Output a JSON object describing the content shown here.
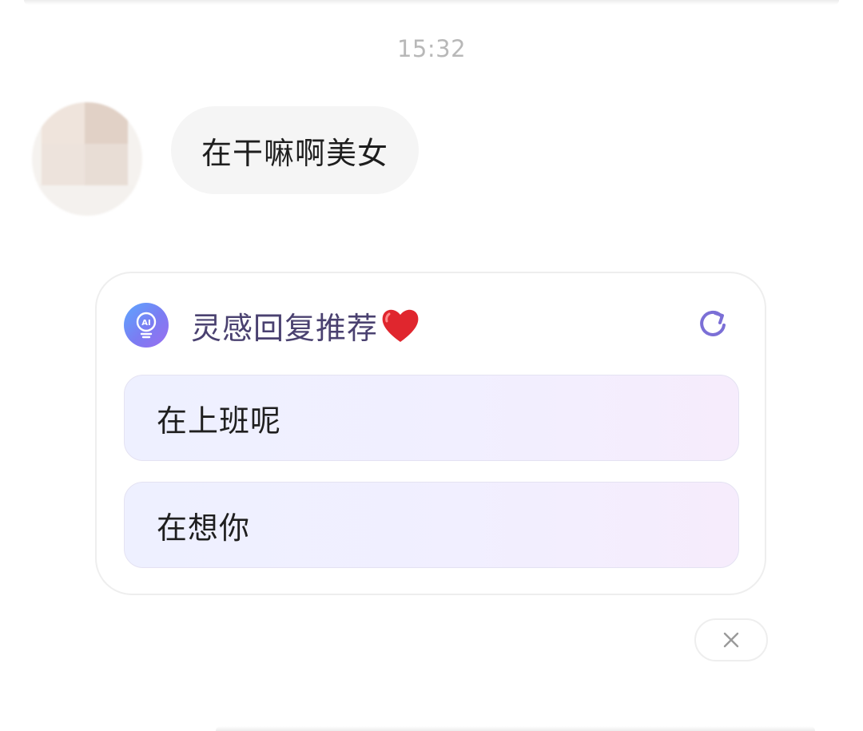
{
  "chat": {
    "timestamp": "15:32",
    "incoming_message": "在干嘛啊美女"
  },
  "suggestion_card": {
    "title": "灵感回复推荐",
    "title_emoji": "red-heart-icon",
    "ai_icon_label": "AI",
    "options": [
      {
        "label": "在上班呢"
      },
      {
        "label": "在想你"
      }
    ]
  },
  "icons": {
    "ai": "ai-lightbulb-icon",
    "refresh": "refresh-icon",
    "close": "close-icon",
    "heart": "red-heart-icon"
  },
  "colors": {
    "accent": "#7b6fd6",
    "title_text": "#4a4170",
    "timestamp": "#b8b8b8",
    "heart": "#e0262e"
  }
}
